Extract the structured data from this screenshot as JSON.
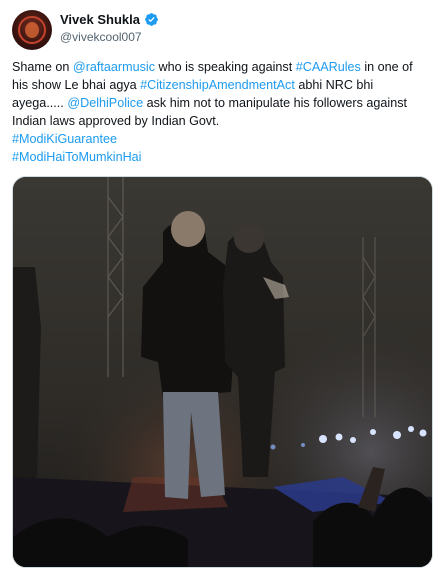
{
  "author": {
    "display_name": "Vivek Shukla",
    "handle": "@vivekcool007",
    "verified": true,
    "avatar_icon": "profile-avatar"
  },
  "tweet": {
    "lines": [
      [
        {
          "text": "Shame on ",
          "type": "text"
        },
        {
          "text": "@raftaarmusic",
          "type": "mention"
        },
        {
          "text": " who is speaking against ",
          "type": "text"
        },
        {
          "text": "#CAARules",
          "type": "hashtag"
        },
        {
          "text": " in one of",
          "type": "text"
        }
      ],
      [
        {
          "text": "his show Le bhai agya ",
          "type": "text"
        },
        {
          "text": "#CitizenshipAmendmentAct",
          "type": "hashtag"
        },
        {
          "text": " abhi NRC bhi",
          "type": "text"
        }
      ],
      [
        {
          "text": "ayega..... ",
          "type": "text"
        },
        {
          "text": "@DelhiPolice",
          "type": "mention"
        },
        {
          "text": " ask him not to manipulate his followers against",
          "type": "text"
        }
      ],
      [
        {
          "text": "Indian laws approved by Indian Govt.",
          "type": "text"
        }
      ],
      [
        {
          "text": "#ModiKiGuarantee",
          "type": "hashtag"
        }
      ],
      [
        {
          "text": "#ModiHaiToMumkinHai",
          "type": "hashtag"
        }
      ]
    ]
  },
  "media": {
    "type": "video-frame",
    "description_icon": "concert-stage-video"
  },
  "colors": {
    "link": "#1d9bf0",
    "text": "#0f1419",
    "secondary": "#536471",
    "verified": "#1d9bf0"
  }
}
